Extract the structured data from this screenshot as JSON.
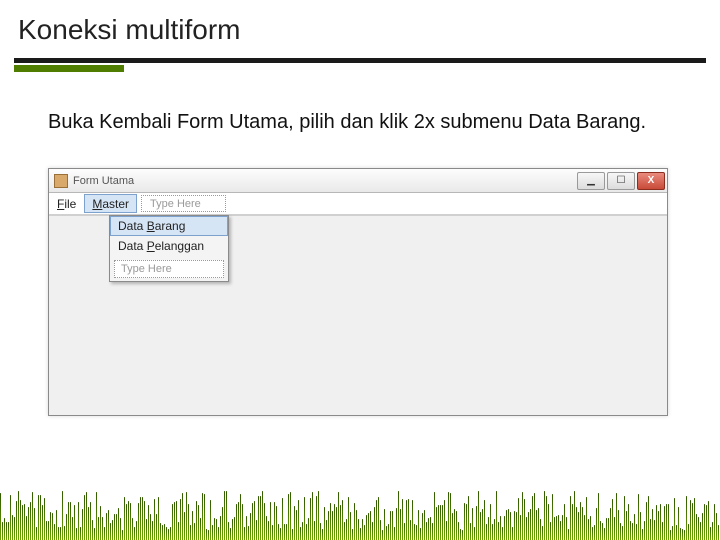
{
  "slide": {
    "title": "Koneksi multiform",
    "instruction": "Buka Kembali Form Utama, pilih dan klik 2x submenu Data Barang."
  },
  "form": {
    "window_title": "Form Utama",
    "menubar": {
      "file_html": "<u>F</u>ile",
      "master_html": "<u>M</u>aster",
      "type_here_placeholder": "Type Here"
    },
    "dropdown": {
      "items": [
        {
          "html": "Data <u>B</u>arang"
        },
        {
          "html": "Data <u>P</u>elanggan"
        }
      ],
      "type_here_placeholder": "Type Here"
    },
    "window_controls": {
      "minimize": "▁",
      "maximize": "☐",
      "close": "X"
    }
  }
}
